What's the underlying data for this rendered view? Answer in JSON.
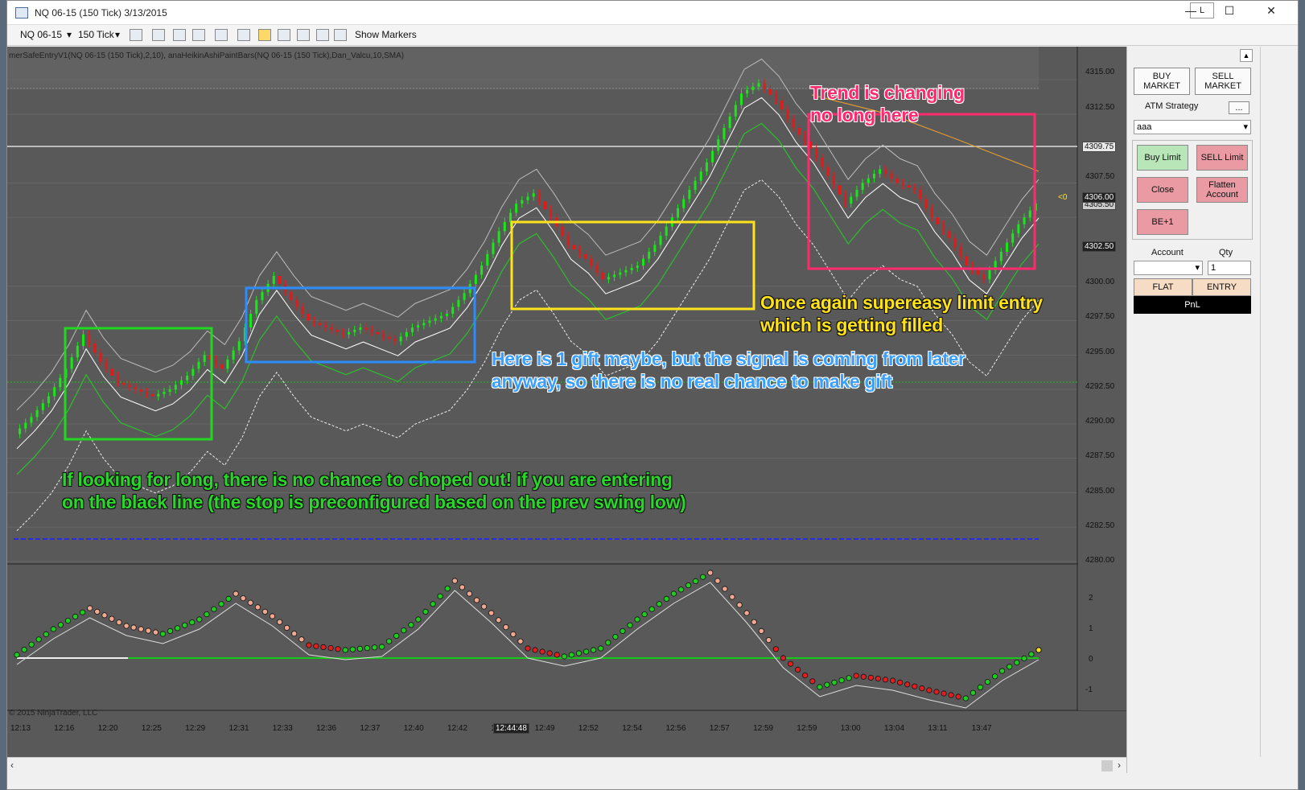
{
  "window": {
    "title": "NQ 06-15 (150 Tick)  3/13/2015",
    "l_button": "L",
    "minimize_glyph": "—",
    "maximize_glyph": "☐",
    "close_glyph": "✕"
  },
  "toolbar": {
    "instrument": "NQ 06-15",
    "period": "150 Tick",
    "show_markers": "Show Markers"
  },
  "chart": {
    "indicator_label": "merSafeEntryV1(NQ 06-15 (150 Tick),2,10), anaHeikinAshiPaintBars(NQ 06-15 (150 Tick),Dan_Valcu,10,SMA)",
    "copyright": "© 2015 NinjaTrader, LLC",
    "price_labels": [
      "4315.00",
      "4312.50",
      "4307.50",
      "4305.00",
      "4300.00",
      "4297.50",
      "4295.00",
      "4292.50",
      "4290.00",
      "4287.50",
      "4285.00",
      "4282.50",
      "4280.00"
    ],
    "price_boxes": {
      "upper": "4309.75",
      "current": "4306.00",
      "hidden": "4305.50",
      "lower": "4302.50"
    },
    "position_marker": "<0",
    "time_labels": [
      "12:13",
      "12:16",
      "12:20",
      "12:25",
      "12:29",
      "12:31",
      "12:33",
      "12:36",
      "12:37",
      "12:40",
      "12:42",
      "12:46",
      "12:49",
      "12:52",
      "12:54",
      "12:56",
      "12:57",
      "12:59",
      "12:59",
      "13:00",
      "13:04",
      "13:11",
      "13:47"
    ],
    "cursor_time": "12:44:48",
    "osc_labels": [
      "2",
      "1",
      "0",
      "-1"
    ]
  },
  "annotations": {
    "green": "If looking for long, there is no chance to choped out! if you are entering\non the black line (the stop is preconfigured based on the prev swing low)",
    "yellow": "Once again supereasy limit entry\nwhich is getting filled",
    "blue": "Here is 1 gift maybe, but the signal is coming from later\nanyway, so there is no real chance to make gift",
    "pink": "Trend is changing\nno long here"
  },
  "panel": {
    "buy_market": "BUY\nMARKET",
    "sell_market": "SELL\nMARKET",
    "atm_label": "ATM Strategy",
    "atm_dots": "...",
    "atm_value": "aaa",
    "buy_limit": "Buy Limit",
    "sell_limit": "SELL Limit",
    "close": "Close",
    "flatten": "Flatten\nAccount",
    "be": "BE+1",
    "account_label": "Account",
    "qty_label": "Qty",
    "qty_value": "1",
    "flat": "FLAT",
    "entry": "ENTRY",
    "pnl": "PnL"
  },
  "chart_data": {
    "type": "candlestick",
    "price_axis": {
      "min": 4280.0,
      "max": 4316.0,
      "ticks": [
        4280,
        4282.5,
        4285,
        4287.5,
        4290,
        4292.5,
        4295,
        4297.5,
        4300,
        4305,
        4307.5,
        4312.5,
        4315
      ]
    },
    "oscillator_axis": {
      "min": -1.5,
      "max": 2.5,
      "ticks": [
        -1,
        0,
        1,
        2
      ]
    },
    "close_path": [
      4289.25,
      4290.5,
      4292.0,
      4294.0,
      4296.5,
      4294.5,
      4293.0,
      4292.5,
      4292.0,
      4292.5,
      4293.5,
      4295.0,
      4294.0,
      4296.0,
      4299.0,
      4300.75,
      4299.0,
      4297.5,
      4297.0,
      4296.5,
      4297.0,
      4296.5,
      4296.0,
      4297.0,
      4297.5,
      4298.0,
      4299.5,
      4301.5,
      4304.0,
      4306.0,
      4306.75,
      4305.0,
      4303.0,
      4302.0,
      4300.5,
      4301.0,
      4301.5,
      4303.0,
      4305.0,
      4307.0,
      4309.0,
      4311.5,
      4314.0,
      4314.75,
      4313.5,
      4311.5,
      4310.0,
      4308.0,
      4306.0,
      4307.5,
      4308.5,
      4307.5,
      4307.0,
      4305.0,
      4303.5,
      4301.5,
      4300.5,
      4302.5,
      4304.5,
      4306.0
    ],
    "oscillator": [
      0.1,
      0.9,
      1.55,
      1.0,
      0.75,
      1.2,
      2.0,
      1.3,
      0.4,
      0.25,
      0.35,
      1.2,
      2.4,
      1.4,
      0.3,
      0.05,
      0.3,
      1.2,
      2.0,
      2.65,
      1.4,
      0.0,
      -0.9,
      -0.55,
      -0.7,
      -1.0,
      -1.25,
      -0.4,
      0.25
    ]
  }
}
